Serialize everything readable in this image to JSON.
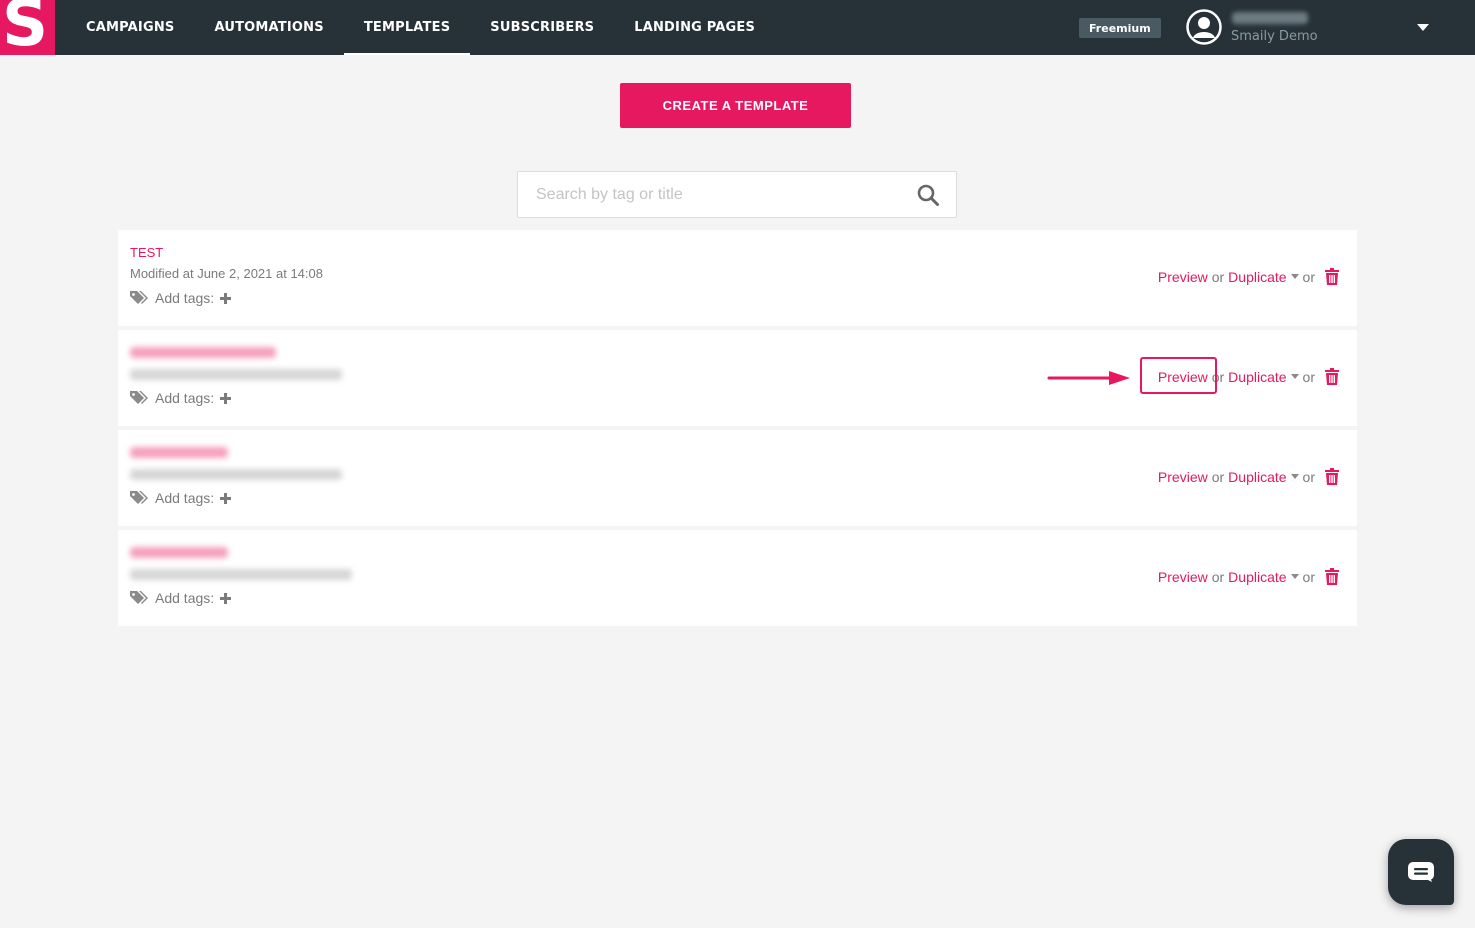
{
  "brand": {
    "logo_letter": "S",
    "accent": "#e6185f",
    "topbar_bg": "#263238"
  },
  "nav": {
    "items": [
      {
        "label": "CAMPAIGNS",
        "active": false
      },
      {
        "label": "AUTOMATIONS",
        "active": false
      },
      {
        "label": "TEMPLATES",
        "active": true
      },
      {
        "label": "SUBSCRIBERS",
        "active": false
      },
      {
        "label": "LANDING PAGES",
        "active": false
      }
    ]
  },
  "account": {
    "plan_badge": "Freemium",
    "organization": "Smaily Demo",
    "avatar_icon": "user-circle-icon",
    "menu_icon": "caret-down-icon"
  },
  "main": {
    "create_button": "CREATE A TEMPLATE",
    "search": {
      "placeholder": "Search by tag or title",
      "icon": "search-icon"
    }
  },
  "templates": [
    {
      "title": "TEST",
      "modified": "Modified at June 2, 2021 at 14:08",
      "redacted": false
    },
    {
      "title": "",
      "modified": "",
      "redacted": true
    },
    {
      "title": "",
      "modified": "",
      "redacted": true
    },
    {
      "title": "",
      "modified": "",
      "redacted": true
    }
  ],
  "row_labels": {
    "add_tags": "Add tags:",
    "preview": "Preview",
    "or": "or",
    "duplicate": "Duplicate",
    "tag_icon": "tags-icon",
    "plus_icon": "plus-icon",
    "trash_icon": "trash-icon"
  },
  "annotation": {
    "highlight_target": "Preview",
    "arrow_icon": "arrow-right-icon"
  },
  "chat": {
    "icon": "chat-bubble-icon"
  }
}
